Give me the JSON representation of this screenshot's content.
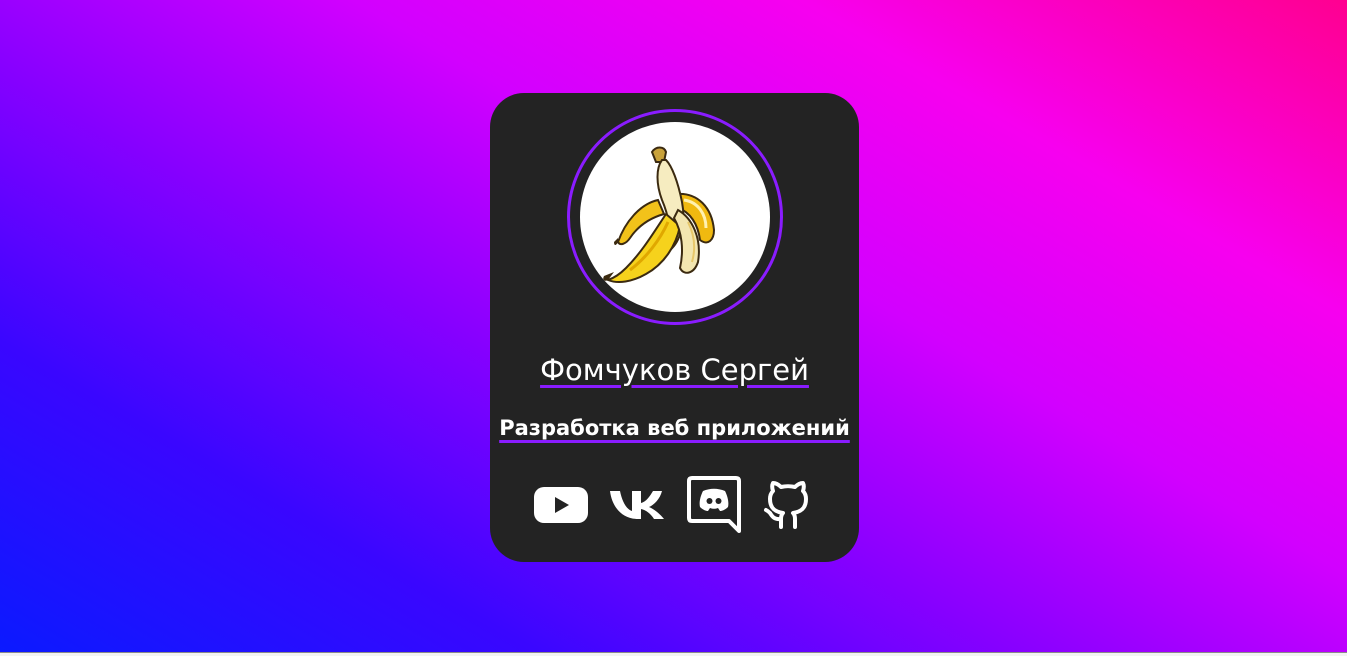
{
  "profile": {
    "name": "Фомчуков Сергей",
    "role": "Разработка веб приложений",
    "avatar_icon": "banana-icon"
  },
  "socials": [
    {
      "name": "youtube",
      "icon": "youtube-icon"
    },
    {
      "name": "vk",
      "icon": "vk-icon"
    },
    {
      "name": "discord",
      "icon": "discord-icon"
    },
    {
      "name": "github",
      "icon": "github-icon"
    }
  ],
  "colors": {
    "card": "#232323",
    "accent": "#8a1cff",
    "text": "#ffffff",
    "gradient_start": "#0a1aff",
    "gradient_end": "#ff0090"
  }
}
